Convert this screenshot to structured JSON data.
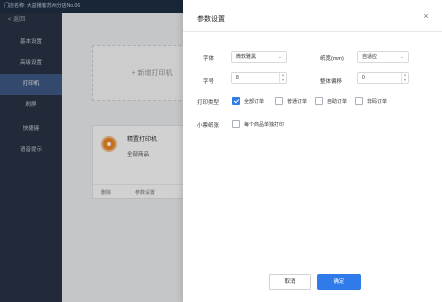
{
  "topbar": {
    "store_label": "门店名称:  大益播客苏州分店No.06"
  },
  "sidebar": {
    "back_label": "< 返回",
    "items": [
      {
        "label": "基本设置"
      },
      {
        "label": "高级设置"
      },
      {
        "label": "打印机"
      },
      {
        "label": "刷屏"
      },
      {
        "label": "快捷键"
      },
      {
        "label": "语音提示"
      }
    ]
  },
  "printers": {
    "add_label": "+ 新增打印机",
    "card": {
      "name": "精置打印机",
      "sub": "全部商品",
      "actions": [
        "删除",
        "参数设置",
        "查阅"
      ]
    }
  },
  "modal": {
    "title": "参数设置",
    "font_label": "字体",
    "font_value": "微软雅黑",
    "paper_label": "纸宽(mm)",
    "paper_value": "自适应",
    "size_label": "字号",
    "size_value": "8",
    "offset_label": "整体偏移",
    "offset_value": "0",
    "type_label": "打印类型",
    "types": [
      {
        "label": "全部订单",
        "checked": true
      },
      {
        "label": "普通订单",
        "checked": false
      },
      {
        "label": "自助订单",
        "checked": false
      },
      {
        "label": "非码订单",
        "checked": false
      }
    ],
    "receipt_label": "小票纸张",
    "receipt_option": "每个商品单独打印",
    "cancel_label": "取消",
    "ok_label": "确定"
  },
  "colors": {
    "primary": "#2f7bea",
    "sidebar_bg": "#2a3447",
    "sidebar_active": "#3f5a86"
  }
}
